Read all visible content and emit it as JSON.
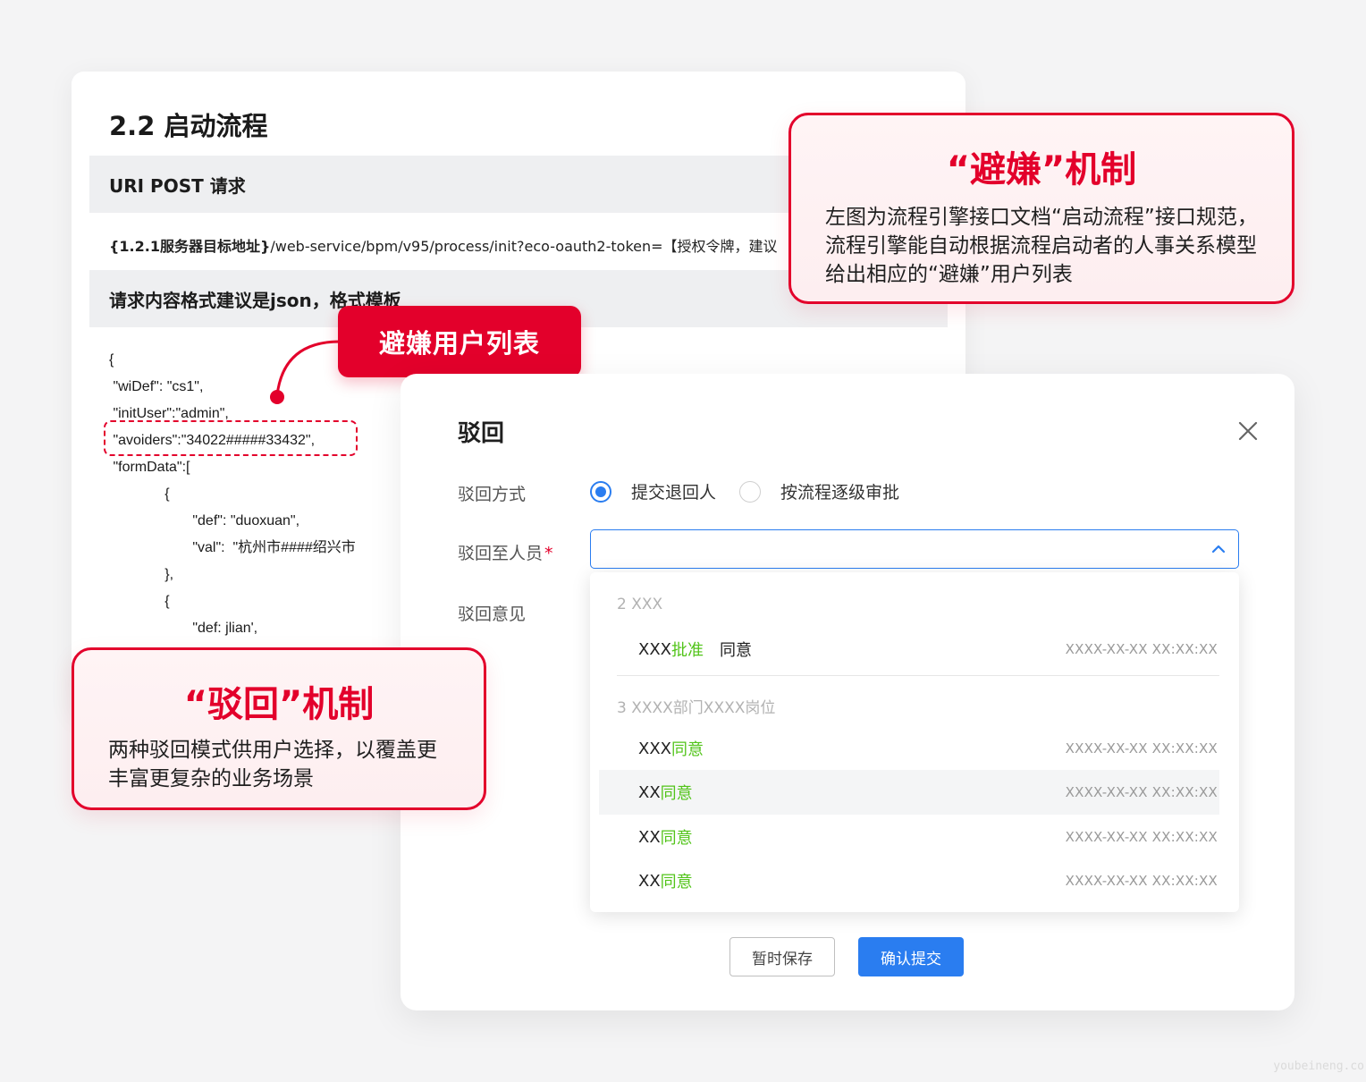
{
  "doc": {
    "title": "2.2 启动流程",
    "uri_band": "URI POST 请求",
    "url_bold": "{1.2.1服务器目标地址}",
    "url_rest": "/web-service/bpm/v95/process/init?eco-oauth2-token=【授权令牌，建议",
    "format_band": "请求内容格式建议是json，格式模板",
    "code_lines": [
      "{",
      " \"wiDef\": \"cs1\",",
      " \"initUser\":\"admin\",",
      " \"avoiders\":\"34022#####33432\",",
      " \"formData\":[",
      "              {",
      "                     \"def\": \"duoxuan\",",
      "                     \"val\":  \"杭州市####绍兴市",
      "              },",
      "              {",
      "                     \"def: jlian',"
    ]
  },
  "tag": {
    "label": "避嫌用户列表"
  },
  "callout_right": {
    "title": "“避嫌”机制",
    "text": "左图为流程引擎接口文档“启动流程”接口规范，流程引擎能自动根据流程启动者的人事关系模型给出相应的“避嫌”用户列表"
  },
  "callout_left": {
    "title": "“驳回”机制",
    "text": "两种驳回模式供用户选择，以覆盖更丰富更复杂的业务场景"
  },
  "modal": {
    "title": "驳回",
    "labels": {
      "method": "驳回方式",
      "to_person": "驳回至人员",
      "required_mark": "*",
      "opinion": "驳回意见"
    },
    "radio_options": [
      "提交退回人",
      "按流程逐级审批"
    ],
    "selected_radio": "提交退回人",
    "dropdown": {
      "group1": "2 XXX",
      "group1_items": [
        {
          "name": "XXX",
          "status": "批准",
          "extra": "同意",
          "time": "XXXX-XX-XX  XX:XX:XX"
        }
      ],
      "group2": "3 XXXX部门XXXX岗位",
      "group2_items": [
        {
          "name": "XXX",
          "status": "同意",
          "time": "XXXX-XX-XX  XX:XX:XX"
        },
        {
          "name": "XX",
          "status": "同意",
          "time": "XXXX-XX-XX  XX:XX:XX"
        },
        {
          "name": "XX",
          "status": "同意",
          "time": "XXXX-XX-XX  XX:XX:XX"
        },
        {
          "name": "XX",
          "status": "同意",
          "time": "XXXX-XX-XX  XX:XX:XX"
        }
      ]
    },
    "buttons": {
      "save": "暂时保存",
      "submit": "确认提交"
    },
    "colors": {
      "primary": "#2a7df0",
      "approve_green": "#52c41a",
      "brand_red": "#e3002b"
    }
  },
  "watermark": "youbeineng.co"
}
